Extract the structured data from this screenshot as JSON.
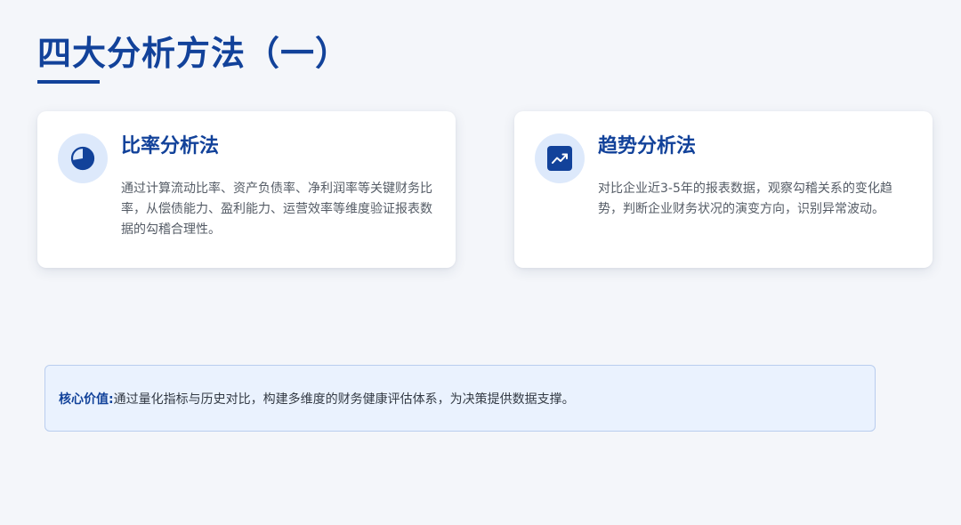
{
  "title": "四大分析方法（一）",
  "cards": [
    {
      "icon": "pie-chart-icon",
      "title": "比率分析法",
      "text": "通过计算流动比率、资产负债率、净利润率等关键财务比率，从偿债能力、盈利能力、运营效率等维度验证报表数据的勾稽合理性。"
    },
    {
      "icon": "trend-chart-icon",
      "title": "趋势分析法",
      "text": "对比企业近3-5年的报表数据，观察勾稽关系的变化趋势，判断企业财务状况的演变方向，识别异常波动。"
    }
  ],
  "callout": {
    "label": "核心价值:",
    "text": "通过量化指标与历史对比，构建多维度的财务健康评估体系，为决策提供数据支撑。"
  },
  "colors": {
    "primary": "#12429a",
    "background": "#f4f6fa",
    "icon_bg": "#dde9fb",
    "callout_bg": "#eaf2fe",
    "callout_border": "#b9cdee"
  }
}
